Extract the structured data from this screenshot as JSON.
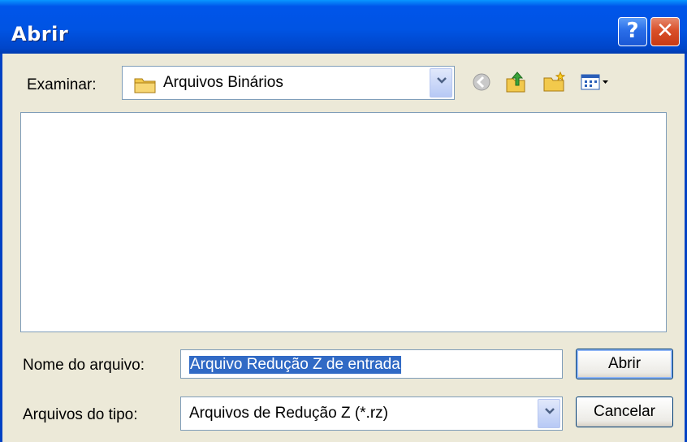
{
  "window": {
    "title": "Abrir",
    "help_label": "?",
    "close_label": "✕"
  },
  "location": {
    "label": "Examinar:",
    "value": "Arquivos Binários"
  },
  "toolbar": {
    "icons": [
      "back-icon",
      "up-folder-icon",
      "new-folder-icon",
      "view-menu-icon"
    ]
  },
  "filename": {
    "label": "Nome do arquivo:",
    "value": "Arquivo Redução Z de entrada"
  },
  "filetype": {
    "label": "Arquivos do tipo:",
    "value": "Arquivos de Redução Z (*.rz)"
  },
  "buttons": {
    "open": "Abrir",
    "cancel": "Cancelar"
  },
  "colors": {
    "titlebar": "#0054e3",
    "selection": "#316ac5",
    "dialog_bg": "#ece9d8"
  }
}
